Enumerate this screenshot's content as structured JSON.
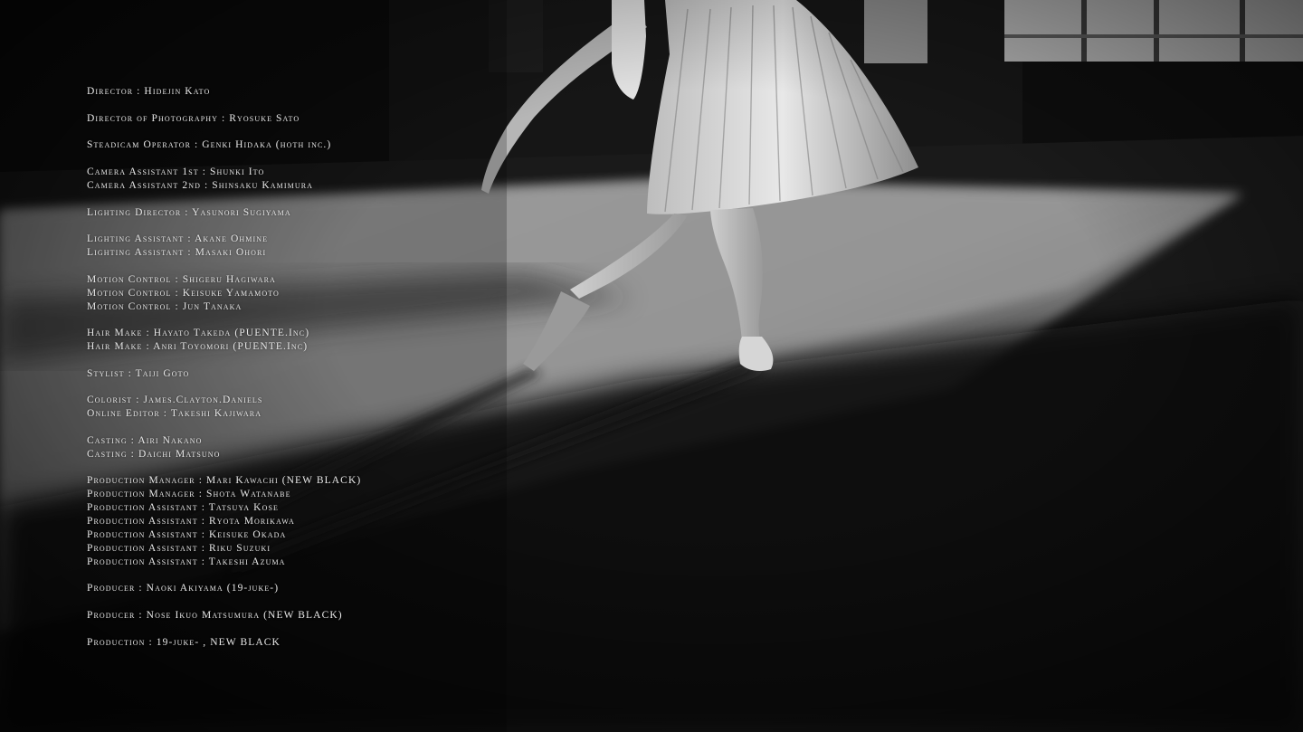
{
  "credits": [
    {
      "lines": [
        "Director : Hidejin Kato"
      ]
    },
    {
      "lines": [
        "Director of Photography : Ryosuke Sato"
      ]
    },
    {
      "lines": [
        "Steadicam Operator : Genki Hidaka  (hoth inc.)"
      ]
    },
    {
      "lines": [
        "Camera Assistant 1st : Shunki Ito",
        "Camera Assistant 2nd : Shinsaku Kamimura"
      ]
    },
    {
      "lines": [
        "Lighting Director : Yasunori Sugiyama"
      ]
    },
    {
      "lines": [
        "Lighting Assistant : Akane Ohmine",
        "Lighting Assistant : Masaki Ohori"
      ]
    },
    {
      "lines": [
        "Motion Control : Shigeru Hagiwara",
        "Motion Control : Keisuke Yamamoto",
        "Motion Control : Jun Tanaka"
      ]
    },
    {
      "lines": [
        "Hair Make : Hayato Takeda (PUENTE.Inc)",
        "Hair Make : Anri Toyomori (PUENTE.Inc)"
      ]
    },
    {
      "lines": [
        "Stylist : Taiji Goto"
      ]
    },
    {
      "lines": [
        "Colorist : James.Clayton.Daniels",
        "Online Editor : Takeshi Kajiwara"
      ]
    },
    {
      "lines": [
        "Casting : Airi Nakano",
        "Casting : Daichi Matsuno"
      ]
    },
    {
      "lines": [
        "Production Manager : Mari Kawachi (NEW BLACK)",
        "Production Manager : Shota Watanabe",
        "Production Assistant : Tatsuya Kose",
        "Production Assistant : Ryota Morikawa",
        "Production Assistant : Keisuke Okada",
        "Production Assistant : Riku Suzuki",
        "Production Assistant : Takeshi Azuma"
      ]
    },
    {
      "lines": [
        "Producer : Naoki Akiyama (19-juke-)"
      ]
    },
    {
      "lines": [
        "Producer : Nose Ikuo Matsumura (NEW BLACK)"
      ]
    },
    {
      "lines": [
        "Production : 19-juke- , NEW BLACK"
      ]
    }
  ],
  "colors": {
    "credit_text": "#e9e9e9",
    "background": "#0c0c0c",
    "light_patch": "#bdbdbd"
  }
}
